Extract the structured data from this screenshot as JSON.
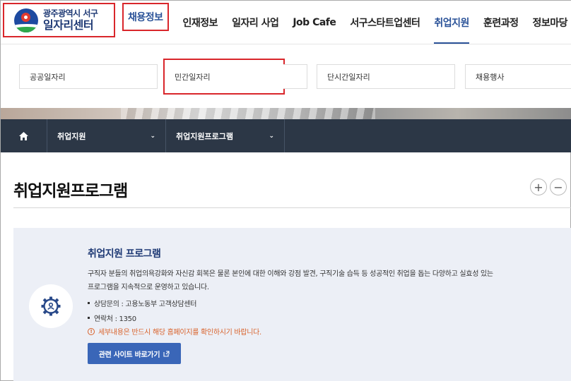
{
  "header": {
    "logo_sub": "광주광역시 서구",
    "logo_main": "일자리센터",
    "menu": [
      {
        "label": "채용정보"
      },
      {
        "label": "인재정보"
      },
      {
        "label": "일자리 사업"
      },
      {
        "label": "Job Cafe"
      },
      {
        "label": "서구스타트업센터"
      },
      {
        "label": "취업지원"
      },
      {
        "label": "훈련과정"
      },
      {
        "label": "정보마당"
      }
    ],
    "active_menu": "취업지원",
    "boxed_menu": "채용정보"
  },
  "submenu": [
    {
      "label": "공공일자리"
    },
    {
      "label": "민간일자리"
    },
    {
      "label": "단시간일자리"
    },
    {
      "label": "채용행사"
    }
  ],
  "location": {
    "home_icon": "home-icon",
    "depth1": "취업지원",
    "depth2": "취업지원프로그램"
  },
  "page": {
    "title": "취업지원프로그램",
    "zoom_in": "+",
    "zoom_out": "−"
  },
  "program": {
    "icon": "person-gear-icon",
    "title": "취업지원 프로그램",
    "desc_line1": "구직자 분들의 취업의욕강화와 자신감 회복은 물론 본인에 대한 이해와 강점 발견, 구직기술 습득 등 성공적인 취업을 돕는 다양하고 실효성 있는",
    "desc_line2": "프로그램을 지속적으로 운영하고 있습니다.",
    "contact": "상담문의 : 고용노동부 고객상담센터",
    "phone": "연락처 : 1350",
    "notice": "세부내용은 반드시 해당 홈페이지를 확인하시기 바랍니다.",
    "button": "관련 사이트 바로가기"
  },
  "colors": {
    "brand_navy": "#1f3a75",
    "accent_blue": "#2a5298",
    "highlight_red": "#d9262b",
    "nav_bar": "#2c3746",
    "card_bg": "#eceff6",
    "notice_orange": "#d9622b",
    "button_blue": "#3a66b8"
  }
}
